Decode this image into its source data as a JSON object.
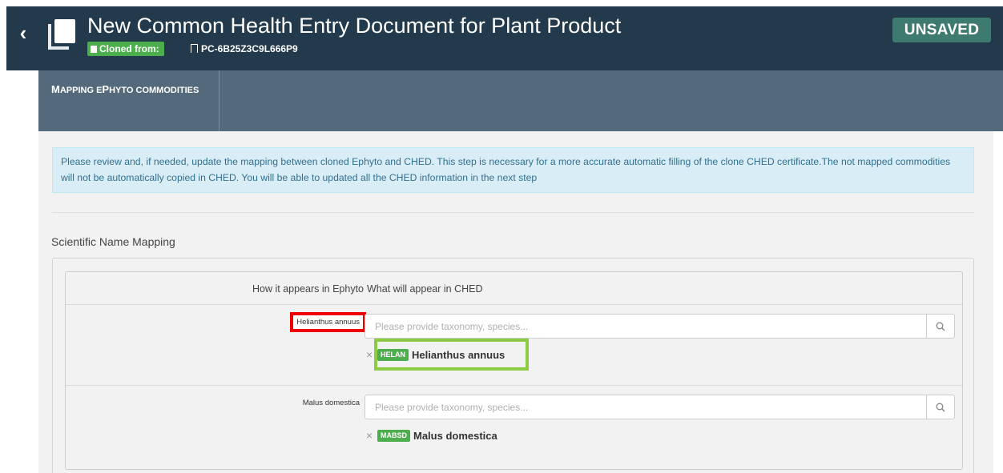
{
  "header": {
    "title": "New Common Health Entry Document for Plant Product",
    "cloned_label": "Cloned from:",
    "reference": "PC-6B25Z3C9L666P9",
    "status": "UNSAVED"
  },
  "tabs": [
    {
      "label_prefix_large": "M",
      "label_part1": "APPING E",
      "label_large2": "P",
      "label_part2": "HYTO COMMODITIES"
    }
  ],
  "info_message": "Please review and, if needed, update the mapping between cloned Ephyto and CHED. This step is necessary for a more accurate automatic filling of the clone CHED certificate.The not mapped commodities will not be automatically copied in CHED. You will be able to updated all the CHED information in the next step",
  "section_title": "Scientific Name Mapping",
  "mapping": {
    "col_ephyto": "How it appears in Ephyto",
    "col_ched": "What will appear in CHED",
    "rows": [
      {
        "ephyto_name": "Helianthus annuus",
        "placeholder": "Please provide taxonomy, species...",
        "code": "HELAN",
        "ched_name": "Helianthus annuus"
      },
      {
        "ephyto_name": "Malus domestica",
        "placeholder": "Please provide taxonomy, species...",
        "code": "MABSD",
        "ched_name": "Malus domestica"
      }
    ]
  },
  "colors": {
    "header_bg": "#223a4b",
    "tab_bg": "#54697a",
    "badge_green": "#4cae4c",
    "status_bg": "#3e7a6f",
    "highlight_red": "#ee0000",
    "highlight_green": "#8ccc44"
  },
  "icons": [
    "chevron-left-icon",
    "document-copy-icon",
    "copy-icon",
    "bookmark-icon",
    "search-icon",
    "remove-icon"
  ]
}
